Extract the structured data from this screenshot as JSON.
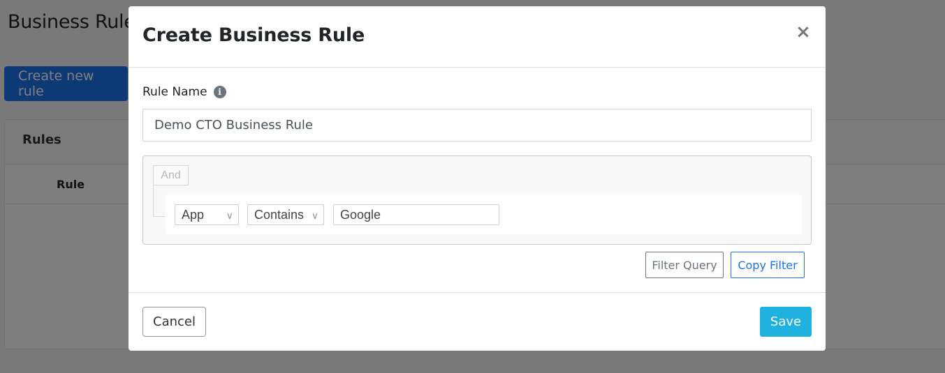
{
  "background": {
    "page_title": "Business Rules",
    "create_button_label": "Create new rule",
    "rules_card_title": "Rules",
    "rules_column_header": "Rule"
  },
  "modal": {
    "title": "Create Business Rule",
    "close_glyph": "×",
    "rule_name": {
      "label": "Rule Name",
      "info_glyph": "i",
      "value": "Demo CTO Business Rule"
    },
    "query_builder": {
      "combinator_label": "And",
      "rule": {
        "field": "App",
        "operator": "Contains",
        "value": "Google"
      },
      "chevron_glyph": "∨"
    },
    "filter_query_label": "Filter Query",
    "copy_filter_label": "Copy Filter",
    "cancel_label": "Cancel",
    "save_label": "Save"
  },
  "colors": {
    "primary": "#1a73e8",
    "save": "#1fb2e0",
    "overlay": "rgba(0,0,0,0.5)"
  }
}
